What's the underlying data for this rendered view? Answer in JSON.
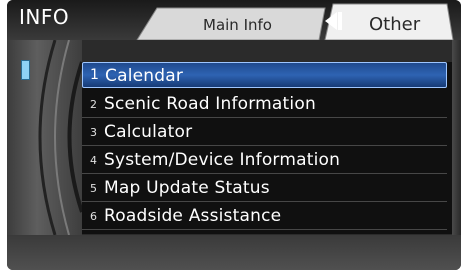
{
  "header": {
    "title": "INFO"
  },
  "tabs": {
    "main": "Main Info",
    "other": "Other"
  },
  "menu": {
    "items": [
      {
        "num": "1",
        "label": "Calendar"
      },
      {
        "num": "2",
        "label": "Scenic Road Information"
      },
      {
        "num": "3",
        "label": "Calculator"
      },
      {
        "num": "4",
        "label": "System/Device Information"
      },
      {
        "num": "5",
        "label": "Map Update Status"
      },
      {
        "num": "6",
        "label": "Roadside Assistance"
      }
    ],
    "selected_index": 0
  },
  "colors": {
    "selection": "#2e63b3",
    "scroll_marker": "#8fd2f5"
  },
  "icons": {
    "back": "back-arrow-icon"
  }
}
